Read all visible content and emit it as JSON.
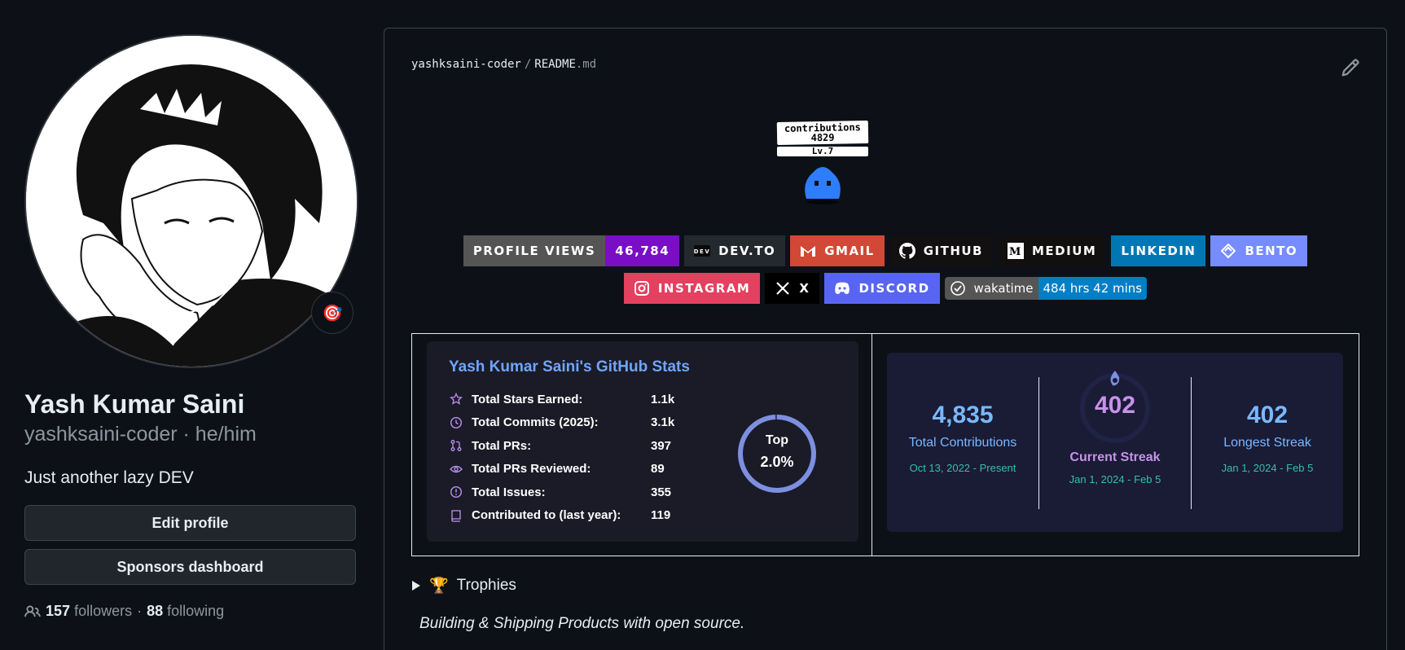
{
  "profile": {
    "fullname": "Yash Kumar Saini",
    "login": "yashksaini-coder · he/him",
    "bio": "Just another lazy DEV",
    "status_emoji": "🎯",
    "edit_label": "Edit profile",
    "sponsors_label": "Sponsors dashboard",
    "followers_count": "157",
    "followers_label": "followers",
    "following_count": "88",
    "following_label": "following",
    "dot": "·"
  },
  "readme": {
    "owner": "yashksaini-coder",
    "sep": "/",
    "file": "README",
    "ext": ".md"
  },
  "pet": {
    "title": "contributions",
    "count": "4829",
    "level": "Lv.7"
  },
  "badges": {
    "views_label": "PROFILE VIEWS",
    "views_value": "46,784",
    "devto": "DEV.TO",
    "gmail": "GMAIL",
    "github": "GITHUB",
    "medium": "MEDIUM",
    "linkedin": "LINKEDIN",
    "bento": "BENTO",
    "instagram": "INSTAGRAM",
    "x": "X",
    "discord": "DISCORD",
    "wakatime_label": "wakatime",
    "wakatime_value": "484 hrs 42 mins"
  },
  "gh_stats": {
    "title": "Yash Kumar Saini's GitHub Stats",
    "rows": [
      {
        "label": "Total Stars Earned:",
        "value": "1.1k",
        "icon": "star-icon"
      },
      {
        "label": "Total Commits (2025):",
        "value": "3.1k",
        "icon": "history-icon"
      },
      {
        "label": "Total PRs:",
        "value": "397",
        "icon": "pull-request-icon"
      },
      {
        "label": "Total PRs Reviewed:",
        "value": "89",
        "icon": "eye-icon"
      },
      {
        "label": "Total Issues:",
        "value": "355",
        "icon": "issue-icon"
      },
      {
        "label": "Contributed to (last year):",
        "value": "119",
        "icon": "repo-icon"
      }
    ],
    "rank_top": "Top",
    "rank_value": "2.0%"
  },
  "streak": {
    "total": "4,835",
    "total_label": "Total Contributions",
    "total_range": "Oct 13, 2022 - Present",
    "current": "402",
    "current_label": "Current Streak",
    "current_range": "Jan 1, 2024 - Feb 5",
    "longest": "402",
    "longest_label": "Longest Streak",
    "longest_range": "Jan 1, 2024 - Feb 5"
  },
  "trophies": {
    "emoji": "🏆",
    "label": "Trophies"
  },
  "tagline": "Building & Shipping Products with open source.",
  "colors": {
    "bg": "#0d1117",
    "accent_blue": "#70a5fd",
    "accent_purple": "#bf91f3",
    "views": "#7a0ec4",
    "gmail": "#d14836",
    "linkedin": "#0077b5",
    "bento": "#768cff",
    "instagram": "#e4405f",
    "discord": "#5865f2"
  }
}
